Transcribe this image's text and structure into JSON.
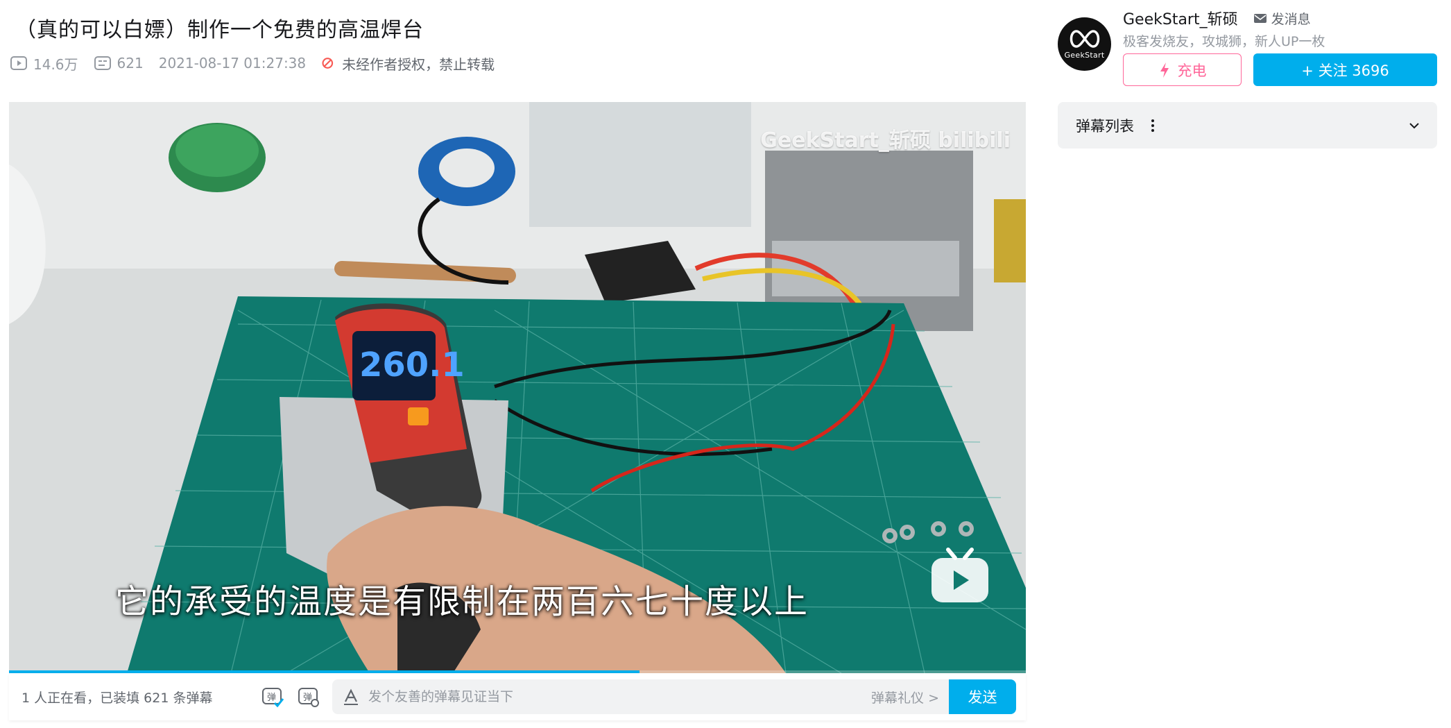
{
  "video": {
    "title": "（真的可以白嫖）制作一个免费的高温焊台",
    "views": "14.6万",
    "danmaku_count": "621",
    "publish_time": "2021-08-17 01:27:38",
    "copyright_notice": "未经作者授权，禁止转载",
    "watermark": "GeekStart_斩硕 bilibili",
    "subtitle": "它的承受的温度是有限制在两百六七十度以上",
    "progress": 0.62
  },
  "sendbar": {
    "viewers_text": "1 人正在看，已装填 621 条弹幕",
    "input_placeholder": "发个友善的弹幕见证当下",
    "etiquette_label": "弹幕礼仪 >",
    "send_label": "发送"
  },
  "uploader": {
    "avatar_text": "GeekStart",
    "name": "GeekStart_斩硕",
    "message_label": "发消息",
    "bio": "极客发烧友，攻城狮，新人UP一枚",
    "charge_label": "充电",
    "follow_label": "+ 关注 3696"
  },
  "danmaku_panel": {
    "title": "弹幕列表"
  },
  "colors": {
    "accent": "#00aeec",
    "charge": "#ff6699",
    "muted": "#9499a0"
  },
  "icons": [
    "play-count-icon",
    "danmaku-count-icon",
    "no-repost-icon",
    "mail-icon",
    "lightning-icon",
    "chevron-down-icon",
    "danmaku-toggle-icon",
    "danmaku-settings-icon",
    "text-style-icon"
  ]
}
